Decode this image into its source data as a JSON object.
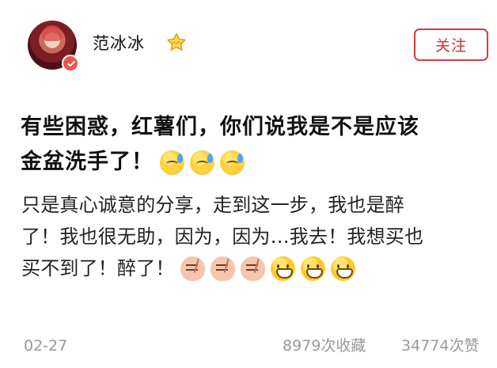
{
  "header": {
    "username": "范冰冰",
    "follow_label": "关注",
    "verified_icon": "verified-badge-icon",
    "badge_icon": "crown-badge-icon",
    "accent_color": "#d9383f"
  },
  "post": {
    "title_line1": "有些困惑，红薯们，你们说我是不是应该",
    "title_line2": "金盆洗手了！",
    "body_line1": "只是真心诚意的分享，走到这一步，我也是醉",
    "body_line2": "了！我也很无助，因为，因为…我去！我想买也",
    "body_line3": "买不到了！醉了！"
  },
  "footer": {
    "date": "02-27",
    "favorites": "8979次收藏",
    "likes": "34774次赞"
  }
}
